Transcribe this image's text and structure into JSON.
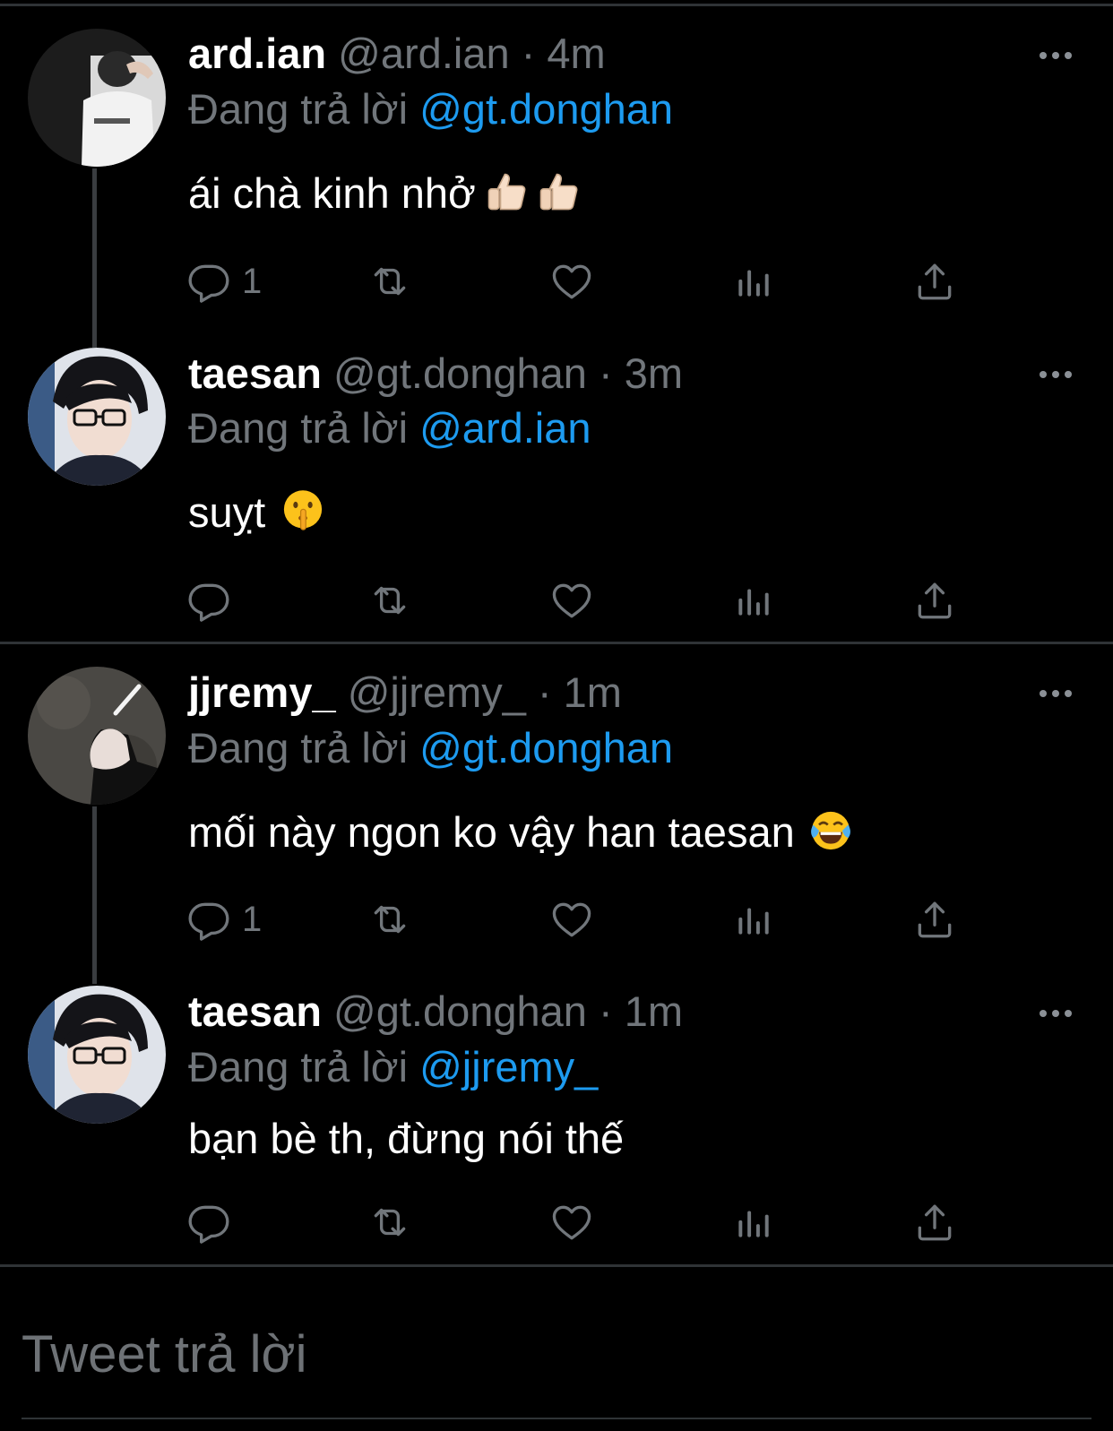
{
  "tweets": [
    {
      "name": "ard.ian",
      "handle_time": "@ard.ian · 4m",
      "reply_prefix": "Đang trả lời",
      "reply_to": "@gt.donghan",
      "text": "ái chà kinh nhở",
      "emojis": [
        "thumbs-up-emoji",
        "thumbs-up-emoji"
      ],
      "reply_count": "1"
    },
    {
      "name": "taesan",
      "handle_time": "@gt.donghan · 3m",
      "reply_prefix": "Đang trả lời",
      "reply_to": "@ard.ian",
      "text": "suỵt",
      "emojis": [
        "shushing-face-emoji"
      ],
      "reply_count": ""
    },
    {
      "name": "jjremy_",
      "handle_time": "@jjremy_ · 1m",
      "reply_prefix": "Đang trả lời",
      "reply_to": "@gt.donghan",
      "text": "mối này ngon ko vậy han taesan",
      "emojis": [
        "tears-of-joy-emoji"
      ],
      "reply_count": "1"
    },
    {
      "name": "taesan",
      "handle_time": "@gt.donghan · 1m",
      "reply_prefix": "Đang trả lời",
      "reply_to": "@jjremy_",
      "text": "bạn bè th, đừng nói thế",
      "emojis": [],
      "reply_count": ""
    }
  ],
  "action_icons": [
    "reply-icon",
    "retweet-icon",
    "like-icon",
    "views-icon",
    "share-icon"
  ],
  "reply_input": {
    "placeholder": "Tweet trả lời"
  },
  "colors": {
    "background": "#000000",
    "mention": "#1d9bf0",
    "muted": "#71767b",
    "text": "#ffffff",
    "divider": "#2f3336"
  }
}
